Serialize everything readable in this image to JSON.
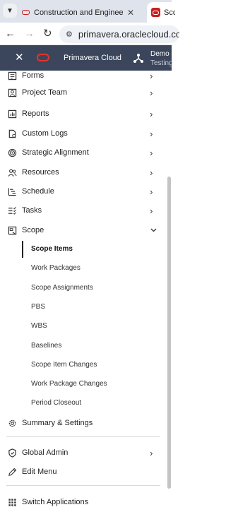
{
  "browser": {
    "tabs": [
      {
        "title": "Construction and Engineering",
        "active": false
      },
      {
        "title": "Scop",
        "active": true
      }
    ],
    "url": "primavera.oraclecloud.com/"
  },
  "app": {
    "title": "Primavera Cloud",
    "user_name": "Demo",
    "user_sub": "Testing",
    "brand_color": "#e0352b",
    "header_color": "#3b465c"
  },
  "menu": {
    "items": [
      {
        "label": "Forms",
        "icon": "forms-icon"
      },
      {
        "label": "Project Team",
        "icon": "team-icon"
      },
      {
        "label": "Reports",
        "icon": "reports-icon"
      },
      {
        "label": "Custom Logs",
        "icon": "custom-logs-icon"
      },
      {
        "label": "Strategic Alignment",
        "icon": "target-icon"
      },
      {
        "label": "Resources",
        "icon": "resources-icon"
      },
      {
        "label": "Schedule",
        "icon": "schedule-icon"
      },
      {
        "label": "Tasks",
        "icon": "tasks-icon"
      },
      {
        "label": "Scope",
        "icon": "scope-icon",
        "expanded": true
      }
    ],
    "scope_items": [
      {
        "label": "Scope Items",
        "selected": true
      },
      {
        "label": "Work Packages"
      },
      {
        "label": "Scope Assignments"
      },
      {
        "label": "PBS"
      },
      {
        "label": "WBS"
      },
      {
        "label": "Baselines"
      },
      {
        "label": "Scope Item Changes"
      },
      {
        "label": "Work Package Changes"
      },
      {
        "label": "Period Closeout"
      }
    ],
    "summary": {
      "label": "Summary & Settings",
      "icon": "gear-icon"
    },
    "global_admin": {
      "label": "Global Admin",
      "icon": "shield-icon"
    },
    "edit_menu": {
      "label": "Edit Menu",
      "icon": "pencil-icon"
    },
    "switch_apps": {
      "label": "Switch Applications",
      "icon": "grid-icon"
    }
  }
}
